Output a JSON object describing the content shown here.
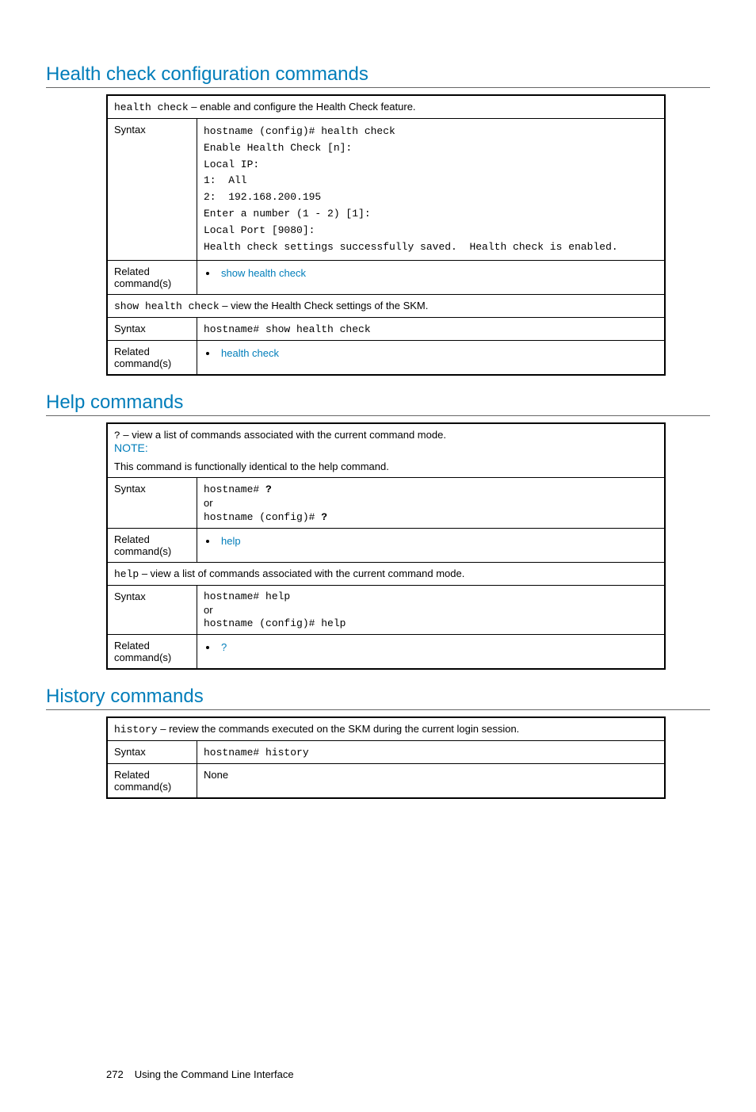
{
  "section1": {
    "heading": "Health check configuration commands",
    "row1": {
      "cmd": "health check",
      "desc": " – enable and configure the Health Check feature."
    },
    "row2": {
      "label": "Syntax",
      "code": "hostname (config)# health check\nEnable Health Check [n]:\nLocal IP:\n1:  All\n2:  192.168.200.195\nEnter a number (1 - 2) [1]:\nLocal Port [9080]:\nHealth check settings successfully saved.  Health check is enabled."
    },
    "row3": {
      "label": "Related command(s)",
      "link": "show health check"
    },
    "row4": {
      "cmd": "show health check",
      "desc": " – view the Health Check settings of the SKM."
    },
    "row5": {
      "label": "Syntax",
      "code": "hostname# show health check"
    },
    "row6": {
      "label": "Related command(s)",
      "link": "health check"
    }
  },
  "section2": {
    "heading": "Help commands",
    "row1": {
      "cmd": "?",
      "desc": " – view a list of commands associated with the current command mode.",
      "noteLabel": "NOTE:",
      "noteText": "This command is functionally identical to the help command."
    },
    "row2": {
      "label": "Syntax",
      "line1": "hostname# ",
      "bold1": "?",
      "or": "or",
      "line2": "hostname (config)# ",
      "bold2": "?"
    },
    "row3": {
      "label": "Related command(s)",
      "link": "help"
    },
    "row4": {
      "cmd": "help",
      "desc": " – view a list of commands associated with the current command mode."
    },
    "row5": {
      "label": "Syntax",
      "line1": "hostname# help",
      "or": "or",
      "line2": "hostname (config)# help"
    },
    "row6": {
      "label": "Related command(s)",
      "link": "?"
    }
  },
  "section3": {
    "heading": "History commands",
    "row1": {
      "cmd": "history",
      "desc": " – review the commands executed on the SKM during the current login session."
    },
    "row2": {
      "label": "Syntax",
      "code": "hostname# history"
    },
    "row3": {
      "label": "Related command(s)",
      "text": "None"
    }
  },
  "footer": {
    "page": "272",
    "text": "Using the Command Line Interface"
  }
}
